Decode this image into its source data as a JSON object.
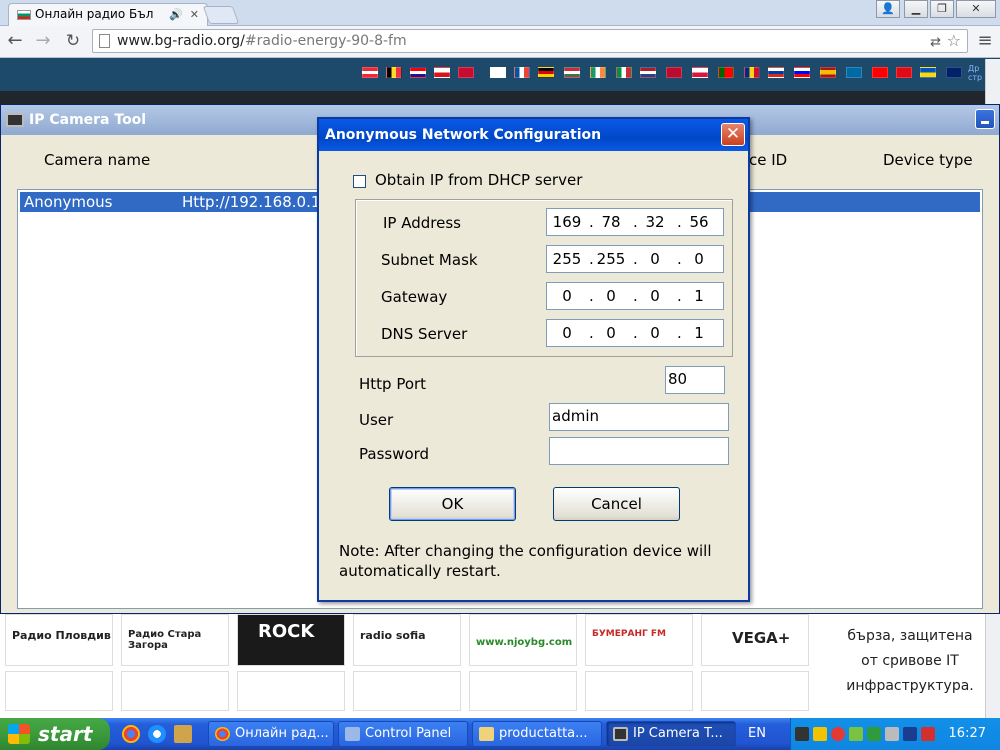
{
  "browser": {
    "tab_title": "Онлайн радио Бъл",
    "url_host": "www.bg-radio.org/",
    "url_path": "#radio-energy-90-8-fm",
    "page_side_text": "Др стр"
  },
  "webpage": {
    "tiles": [
      "Радио Пловдив",
      "Радио Стара Загора",
      "ROCK",
      "radio sofia",
      "www.njoybg.com",
      "БУМЕРАНГ FM",
      "VEGA+"
    ],
    "right_text": "бърза, защитена от сривове IT инфраструктура."
  },
  "ipcam": {
    "title": "IP Camera Tool",
    "columns": {
      "camera_name": "Camera name",
      "device_id": "ce ID",
      "device_type": "Device type"
    },
    "rows": [
      {
        "name": "Anonymous",
        "address": "Http://192.168.0.15"
      }
    ]
  },
  "dialog": {
    "title": "Anonymous Network Configuration",
    "close_glyph": "✕",
    "dhcp_label": "Obtain IP from DHCP server",
    "dhcp_checked": false,
    "ip_label": "IP Address",
    "ip": [
      "169",
      "78",
      "32",
      "56"
    ],
    "subnet_label": "Subnet Mask",
    "subnet": [
      "255",
      "255",
      "0",
      "0"
    ],
    "gateway_label": "Gateway",
    "gateway": [
      "0",
      "0",
      "0",
      "1"
    ],
    "dns_label": "DNS Server",
    "dns": [
      "0",
      "0",
      "0",
      "1"
    ],
    "port_label": "Http Port",
    "port": "80",
    "user_label": "User",
    "user": "admin",
    "password_label": "Password",
    "password": "",
    "ok_label": "OK",
    "cancel_label": "Cancel",
    "note": "Note: After changing the configuration device will automatically restart."
  },
  "taskbar": {
    "start_label": "start",
    "tasks": [
      "Онлайн рад...",
      "Control Panel",
      "productatta...",
      "IP Camera T..."
    ],
    "language": "EN",
    "clock": "16:27"
  }
}
